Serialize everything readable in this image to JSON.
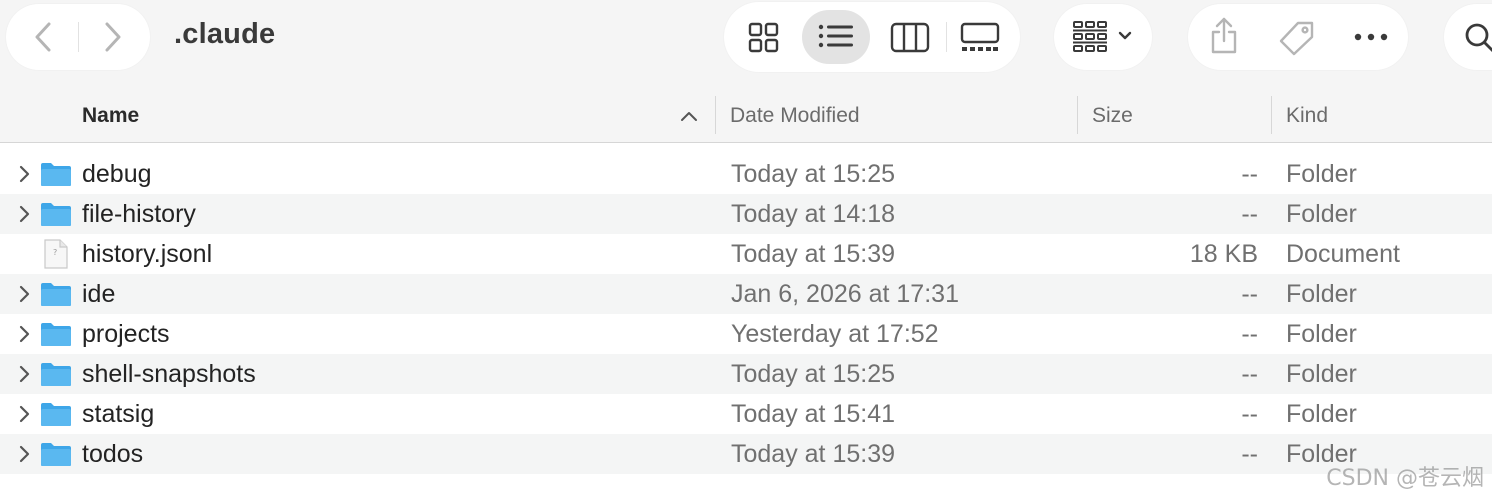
{
  "window": {
    "title": ".claude"
  },
  "toolbar": {
    "nav": [
      "back-icon",
      "forward-icon"
    ],
    "views": [
      "icon-view-icon",
      "list-view-icon",
      "column-view-icon",
      "gallery-view-icon"
    ],
    "active_view": "list-view-icon",
    "group_icon": "group-by-icon",
    "actions": [
      "share-icon",
      "tag-icon",
      "more-icon"
    ],
    "search_icon": "search-icon"
  },
  "columns": {
    "name": "Name",
    "date": "Date Modified",
    "size": "Size",
    "kind": "Kind",
    "sorted_by": "Name",
    "sort_direction": "ascending"
  },
  "rows": [
    {
      "name": "debug",
      "date": "Today at 15:25",
      "size": "--",
      "kind": "Folder",
      "type": "folder"
    },
    {
      "name": "file-history",
      "date": "Today at 14:18",
      "size": "--",
      "kind": "Folder",
      "type": "folder"
    },
    {
      "name": "history.jsonl",
      "date": "Today at 15:39",
      "size": "18 KB",
      "kind": "Document",
      "type": "document"
    },
    {
      "name": "ide",
      "date": "Jan 6, 2026 at 17:31",
      "size": "--",
      "kind": "Folder",
      "type": "folder"
    },
    {
      "name": "projects",
      "date": "Yesterday at 17:52",
      "size": "--",
      "kind": "Folder",
      "type": "folder"
    },
    {
      "name": "shell-snapshots",
      "date": "Today at 15:25",
      "size": "--",
      "kind": "Folder",
      "type": "folder"
    },
    {
      "name": "statsig",
      "date": "Today at 15:41",
      "size": "--",
      "kind": "Folder",
      "type": "folder"
    },
    {
      "name": "todos",
      "date": "Today at 15:39",
      "size": "--",
      "kind": "Folder",
      "type": "folder"
    }
  ],
  "colors": {
    "folder": "#5ab8f0",
    "folder_dark": "#3ea6e8",
    "icon_gray": "#3a3a3a",
    "icon_disabled": "#b5b5b5"
  },
  "watermark": "CSDN @苍云烟"
}
